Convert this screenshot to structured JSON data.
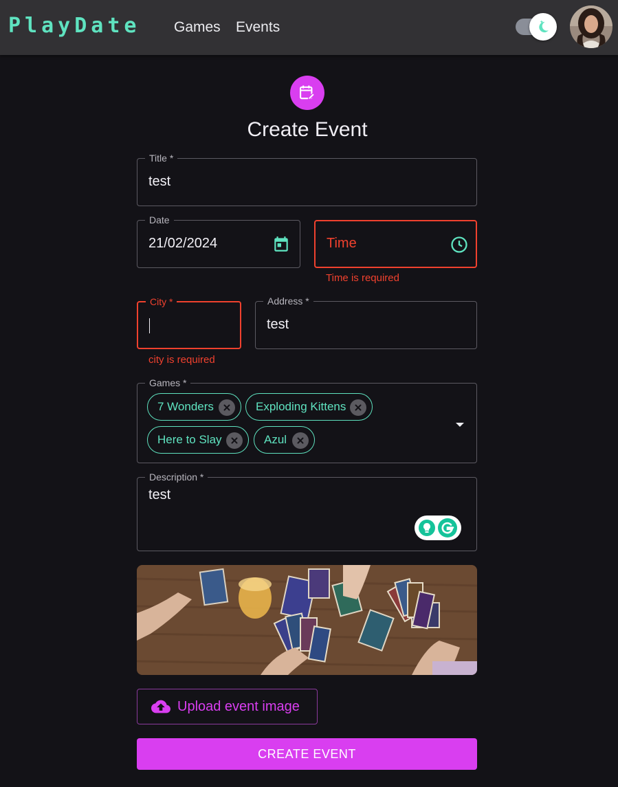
{
  "navbar": {
    "brand": "PlayDate",
    "links": [
      "Games",
      "Events"
    ]
  },
  "page": {
    "title": "Create Event"
  },
  "form": {
    "title_field": {
      "label": "Title *",
      "value": "test"
    },
    "date_field": {
      "label": "Date",
      "value": "21/02/2024"
    },
    "time_field": {
      "placeholder": "Time",
      "error": "Time is required"
    },
    "city_field": {
      "label": "City *",
      "value": "",
      "error": "city is required"
    },
    "address_field": {
      "label": "Address *",
      "value": "test"
    },
    "games_field": {
      "label": "Games *",
      "chips": [
        "7 Wonders",
        "Exploding Kittens",
        "Here to Slay",
        "Azul"
      ]
    },
    "description_field": {
      "label": "Description *",
      "value": "test"
    }
  },
  "buttons": {
    "upload": "Upload event image",
    "create": "CREATE EVENT"
  },
  "colors": {
    "accent": "#d93ef0",
    "brand_teal": "#5fe3c0",
    "error": "#f0412e",
    "background": "#131217",
    "appbar": "#323134"
  },
  "icons": {
    "theme_toggle": "moon-icon",
    "header": "edit-calendar-icon",
    "date": "calendar-icon",
    "time": "clock-icon",
    "chip_remove": "cancel-icon",
    "dropdown": "arrow-drop-down-icon",
    "upload": "cloud-upload-icon"
  }
}
